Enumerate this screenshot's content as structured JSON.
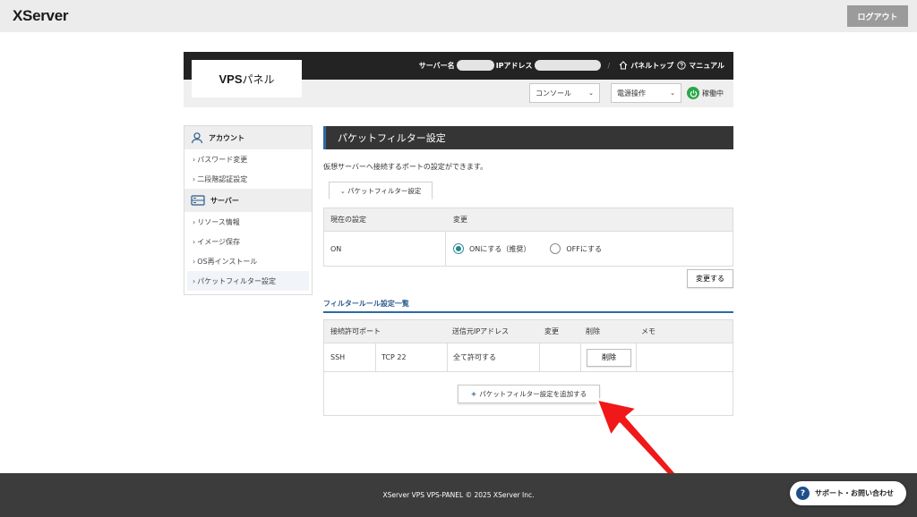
{
  "topbar": {
    "logo": "XServer",
    "logout_label": "ログアウト"
  },
  "panel": {
    "logo_bold": "VPS",
    "logo_rest": "パネル",
    "server_name_label": "サーバー名",
    "ip_label": "IPアドレス",
    "separator": "/",
    "top_link": "パネルトップ",
    "manual_link": "マニュアル",
    "console_select": "コンソール",
    "power_select": "電源操作",
    "status": "稼働中"
  },
  "sidebar": {
    "account_head": "アカウント",
    "account_items": [
      "パスワード変更",
      "二段階認証設定"
    ],
    "server_head": "サーバー",
    "server_items": [
      "リソース情報",
      "イメージ保存",
      "OS再インストール",
      "パケットフィルター設定"
    ]
  },
  "main": {
    "title": "パケットフィルター設定",
    "description": "仮想サーバーへ接続するポートの設定ができます。",
    "tab_label": "パケットフィルター設定",
    "setting_table": {
      "col_current": "現在の設定",
      "col_change": "変更",
      "current_value": "ON",
      "option_on": "ONにする（推奨）",
      "option_off": "OFFにする"
    },
    "change_button": "変更する",
    "rules_title": "フィルタールール設定一覧",
    "rules_table": {
      "headers": {
        "port": "接続許可ポート",
        "source_ip": "送信元IPアドレス",
        "change": "変更",
        "delete": "削除",
        "memo": "メモ"
      },
      "rows": [
        {
          "name": "SSH",
          "port": "TCP 22",
          "source_ip": "全て許可する",
          "delete_label": "削除"
        }
      ]
    },
    "add_button": "パケットフィルター設定を追加する"
  },
  "footer": {
    "copyright": "XServer VPS VPS-PANEL © 2025 XServer Inc.",
    "support_label": "サポート・お問い合わせ"
  },
  "colors": {
    "accent": "#2c6aa8",
    "status_green": "#2ba84a",
    "annotation_arrow": "#f01818"
  }
}
